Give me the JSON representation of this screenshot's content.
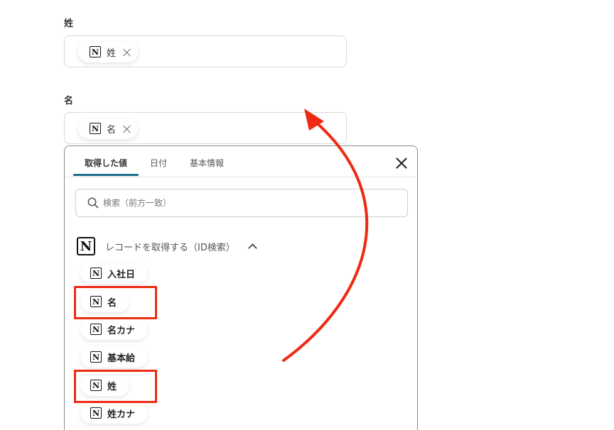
{
  "fields": [
    {
      "label": "姓",
      "chip": "姓"
    },
    {
      "label": "名",
      "chip": "名"
    }
  ],
  "panel": {
    "tabs": [
      "取得した値",
      "日付",
      "基本情報"
    ],
    "search_placeholder": "検索（前方一致）",
    "group_title": "レコードを取得する（ID検索）",
    "options": [
      "入社日",
      "名",
      "名カナ",
      "基本給",
      "姓",
      "姓カナ"
    ]
  },
  "icons": {
    "notion": "notion-icon",
    "remove": "close-icon",
    "panel_close": "close-icon",
    "search": "search-icon",
    "collapse": "chevron-up-icon"
  },
  "colors": {
    "highlight": "#ee2a12",
    "tab_active": "#1f6f8f"
  }
}
